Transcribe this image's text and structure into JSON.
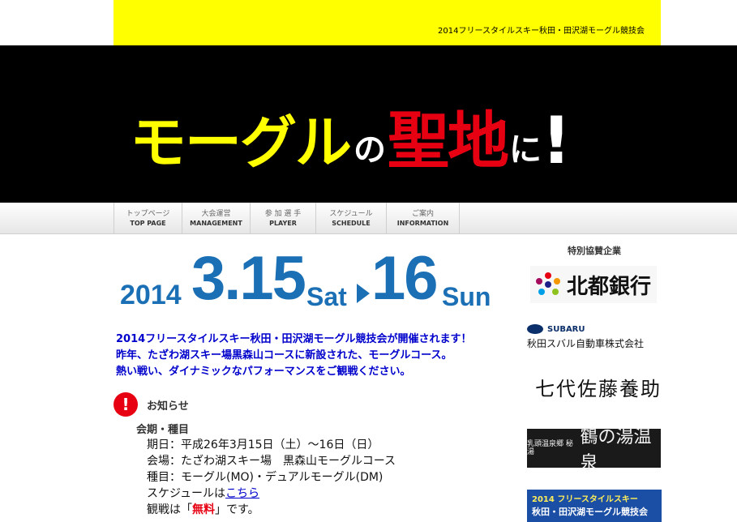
{
  "header": {
    "event_title": "2014フリースタイルスキー秋田・田沢湖モーグル競技会"
  },
  "hero": {
    "part_yellow": "モーグル",
    "part_no": "の",
    "part_red": "聖地",
    "part_ni": "に",
    "part_excl": "!"
  },
  "nav": {
    "items": [
      {
        "jp": "トップページ",
        "en": "TOP PAGE"
      },
      {
        "jp": "大会運営",
        "en": "MANAGEMENT"
      },
      {
        "jp": "参 加 選 手",
        "en": "PLAYER"
      },
      {
        "jp": "スケジュール",
        "en": "SCHEDULE"
      },
      {
        "jp": "ご案内",
        "en": "INFORMATION"
      }
    ]
  },
  "date": {
    "year": "2014",
    "day1": "3.15",
    "day1_dow": "Sat",
    "day2": "16",
    "day2_dow": "Sun"
  },
  "intro": {
    "line1": "2014フリースタイルスキー秋田・田沢湖モーグル競技会が開催されます！",
    "line2": "昨年、たざわ湖スキー場黒森山コースに新設された、モーグルコース。",
    "line3": "熱い戦い、ダイナミックなパフォーマンスをご観戦ください。"
  },
  "notice": {
    "icon": "!",
    "title": "お知らせ",
    "subtitle": "会期・種目",
    "date_line": "期日：平成26年3月15日（土）～16日（日）",
    "venue_line": "会場：たざわ湖スキー場　黒森山モーグルコース",
    "event_line": "種目：モーグル(MO)・デュアルモーグル(DM)",
    "schedule_prefix": "スケジュールは",
    "schedule_link": "こちら",
    "watch_prefix": "観戦は「",
    "watch_free": "無料",
    "watch_suffix": "」です。"
  },
  "sponsors": {
    "heading": "特別協賛企業",
    "hokuto": "北都銀行",
    "subaru_brand": "SUBARU",
    "subaru_name": "秋田スバル自動車株式会社",
    "sato": "七代佐藤養助",
    "onsen_small": "乳頭温泉郷 秘湯",
    "onsen": "鶴の湯温泉",
    "banner_line1": "2014 フリースタイルスキー",
    "banner_line2": "秋田・田沢湖モーグル競技会"
  },
  "colors": {
    "yellow": "#ffff00",
    "red": "#e60012",
    "blue": "#1a6fb5",
    "link_blue": "#0000cc"
  }
}
